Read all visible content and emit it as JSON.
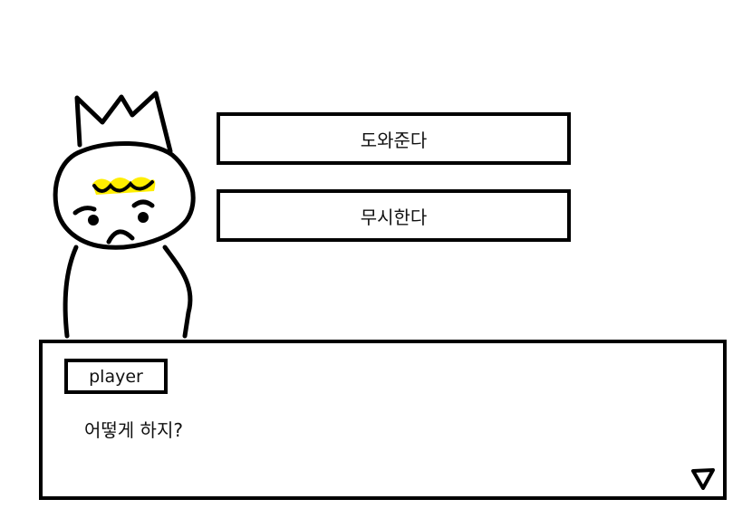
{
  "choices": [
    {
      "label": "도와준다"
    },
    {
      "label": "무시한다"
    }
  ],
  "dialog": {
    "speaker": "player",
    "text": "어떻게 하지?",
    "advance_icon": "advance-triangle-icon"
  },
  "character": {
    "icon": "sad-character-icon",
    "hair_color": "#ffee00"
  },
  "colors": {
    "background": "#ffffff",
    "border": "#000000",
    "text": "#111111"
  }
}
